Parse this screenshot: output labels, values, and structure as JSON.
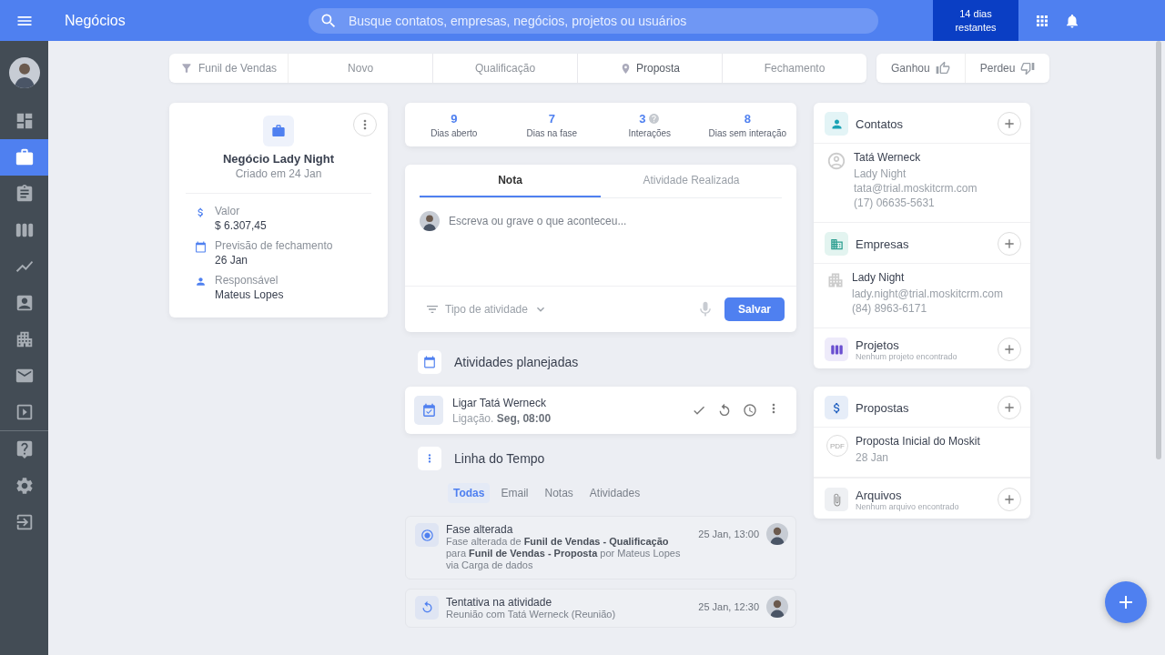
{
  "topbar": {
    "title": "Negócios",
    "search": {
      "placeholder": "Busque contatos, empresas, negócios, projetos ou usuários"
    },
    "trial": "14 dias restantes"
  },
  "sidebar": {
    "items": [
      {
        "kind": "dashboard",
        "selected": false
      },
      {
        "kind": "deals",
        "selected": true
      },
      {
        "kind": "tasks",
        "selected": false
      },
      {
        "kind": "projects",
        "selected": false
      },
      {
        "kind": "reports",
        "selected": false
      },
      {
        "kind": "contacts",
        "selected": false
      },
      {
        "kind": "companies",
        "selected": false
      },
      {
        "kind": "email",
        "selected": false
      },
      {
        "kind": "videos",
        "selected": false
      }
    ],
    "bottom_items": [
      {
        "kind": "help",
        "selected": false
      },
      {
        "kind": "settings",
        "selected": false
      },
      {
        "kind": "logout",
        "selected": false
      }
    ]
  },
  "pipeline": {
    "label": "Funil de Vendas",
    "stages": [
      {
        "label": "Novo",
        "selected": false
      },
      {
        "label": "Qualificação",
        "selected": false
      },
      {
        "label": "Proposta",
        "selected": true
      },
      {
        "label": "Fechamento",
        "selected": false
      }
    ]
  },
  "outcomes": [
    {
      "kind": "won",
      "label": "Ganhou"
    },
    {
      "kind": "lost",
      "label": "Perdeu"
    }
  ],
  "deal": {
    "title": "Negócio Lady Night",
    "created": "Criado em 24 Jan",
    "fields": [
      {
        "kind": "value",
        "label": "Valor",
        "value": "$ 6.307,45"
      },
      {
        "kind": "date",
        "label": "Previsão de fechamento",
        "value": "26 Jan"
      },
      {
        "kind": "owner",
        "label": "Responsável",
        "value": "Mateus Lopes"
      }
    ]
  },
  "stats": [
    {
      "value": "9",
      "label": "Dias aberto",
      "help": false
    },
    {
      "value": "7",
      "label": "Dias na fase",
      "help": false
    },
    {
      "value": "3",
      "label": "Interações",
      "help": true
    },
    {
      "value": "8",
      "label": "Dias sem interação",
      "help": false
    }
  ],
  "composer": {
    "tabs": [
      {
        "label": "Nota",
        "selected": true
      },
      {
        "label": "Atividade Realizada",
        "selected": false
      }
    ],
    "placeholder": "Escreva ou grave o que aconteceu...",
    "activity_type": "Tipo de atividade",
    "save": "Salvar"
  },
  "planned": {
    "title": "Atividades planejadas",
    "items": [
      {
        "title": "Ligar Tatá Werneck",
        "detail": "Ligação. **Seg, 08:00**"
      }
    ]
  },
  "timeline": {
    "title": "Linha do Tempo",
    "filters": [
      {
        "label": "Todas",
        "selected": true
      },
      {
        "label": "Email",
        "selected": false
      },
      {
        "label": "Notas",
        "selected": false
      },
      {
        "label": "Atividades",
        "selected": false
      }
    ],
    "events": [
      {
        "kind": "stage",
        "title": "Fase alterada",
        "text": "Fase alterada de **Funil de Vendas - Qualificação** para **Funil de Vendas - Proposta** por Mateus Lopes via Carga de dados",
        "time": "25 Jan, 13:00"
      },
      {
        "kind": "retry",
        "title": "Tentativa na atividade",
        "text": "Reunião com Tatá Werneck (Reunião)",
        "time": "25 Jan, 12:30"
      }
    ]
  },
  "contacts": {
    "title": "Contatos",
    "items": [
      {
        "name": "Tatá Werneck",
        "company": "Lady Night",
        "email": "tata@trial.moskitcrm.com",
        "phone": "(17) 06635-5631"
      }
    ]
  },
  "companies": {
    "title": "Empresas",
    "items": [
      {
        "name": "Lady Night",
        "email": "lady.night@trial.moskitcrm.com",
        "phone": "(84) 8963-6171"
      }
    ]
  },
  "projects": {
    "title": "Projetos",
    "empty": "Nenhum projeto encontrado"
  },
  "proposals": {
    "title": "Propostas",
    "items": [
      {
        "badge": "PDF",
        "name": "Proposta Inicial do Moskit",
        "date": "28 Jan"
      }
    ]
  },
  "files": {
    "title": "Arquivos",
    "empty": "Nenhum arquivo encontrado"
  }
}
